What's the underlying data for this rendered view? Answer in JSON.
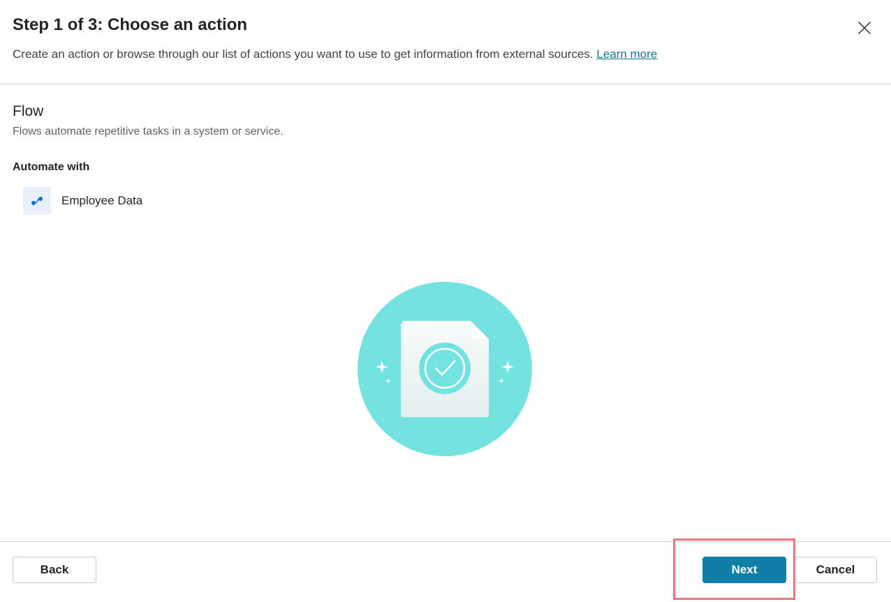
{
  "header": {
    "title": "Step 1 of 3: Choose an action",
    "subtitle": "Create an action or browse through our list of actions you want to use to get information from external sources.",
    "learn_more": "Learn more"
  },
  "section": {
    "title": "Flow",
    "description": "Flows automate repetitive tasks in a system or service.",
    "automate_label": "Automate with",
    "items": [
      {
        "label": "Employee Data",
        "icon": "flow-icon"
      }
    ]
  },
  "footer": {
    "back_label": "Back",
    "next_label": "Next",
    "cancel_label": "Cancel"
  },
  "colors": {
    "primary": "#0f7fa8",
    "illustration_circle": "#74e2df",
    "highlight": "#e8787a",
    "link": "#0e7a8a"
  }
}
